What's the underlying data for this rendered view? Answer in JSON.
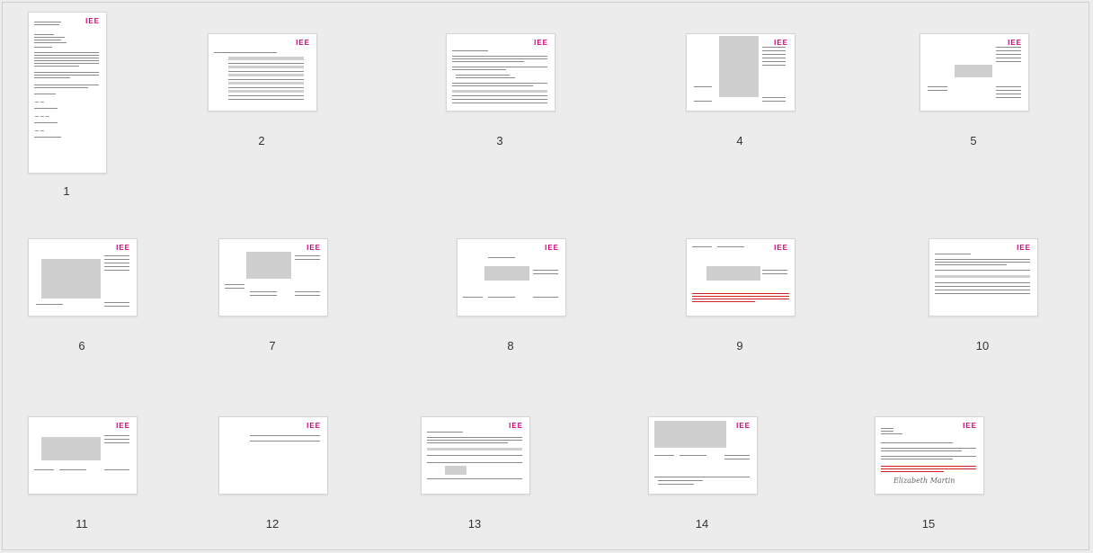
{
  "pages": [
    {
      "number": "1",
      "logo": "IEE"
    },
    {
      "number": "2",
      "logo": "IEE"
    },
    {
      "number": "3",
      "logo": "IEE"
    },
    {
      "number": "4",
      "logo": "IEE"
    },
    {
      "number": "5",
      "logo": "IEE"
    },
    {
      "number": "6",
      "logo": "IEE"
    },
    {
      "number": "7",
      "logo": "IEE"
    },
    {
      "number": "8",
      "logo": "IEE"
    },
    {
      "number": "9",
      "logo": "IEE"
    },
    {
      "number": "10",
      "logo": "IEE"
    },
    {
      "number": "11",
      "logo": "IEE"
    },
    {
      "number": "12",
      "logo": "IEE"
    },
    {
      "number": "13",
      "logo": "IEE"
    },
    {
      "number": "14",
      "logo": "IEE"
    },
    {
      "number": "15",
      "logo": "IEE"
    }
  ],
  "signature": "Elizabeth Martin",
  "colors": {
    "background": "#ececec",
    "page": "#ffffff",
    "logo": "#d4007a",
    "highlight_text": "#d12020",
    "table_fill": "#cfcfcf"
  }
}
